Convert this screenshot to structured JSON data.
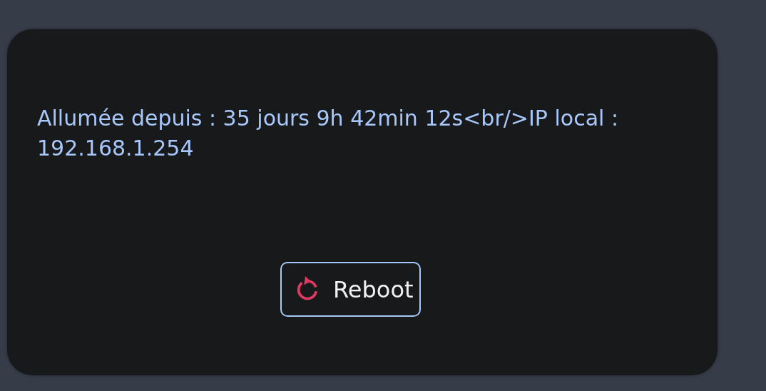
{
  "card": {
    "status_text": "Allumée depuis : 35 jours 9h 42min 12s<br/>IP local : 192.168.1.254",
    "button": {
      "label": "Reboot"
    }
  }
}
